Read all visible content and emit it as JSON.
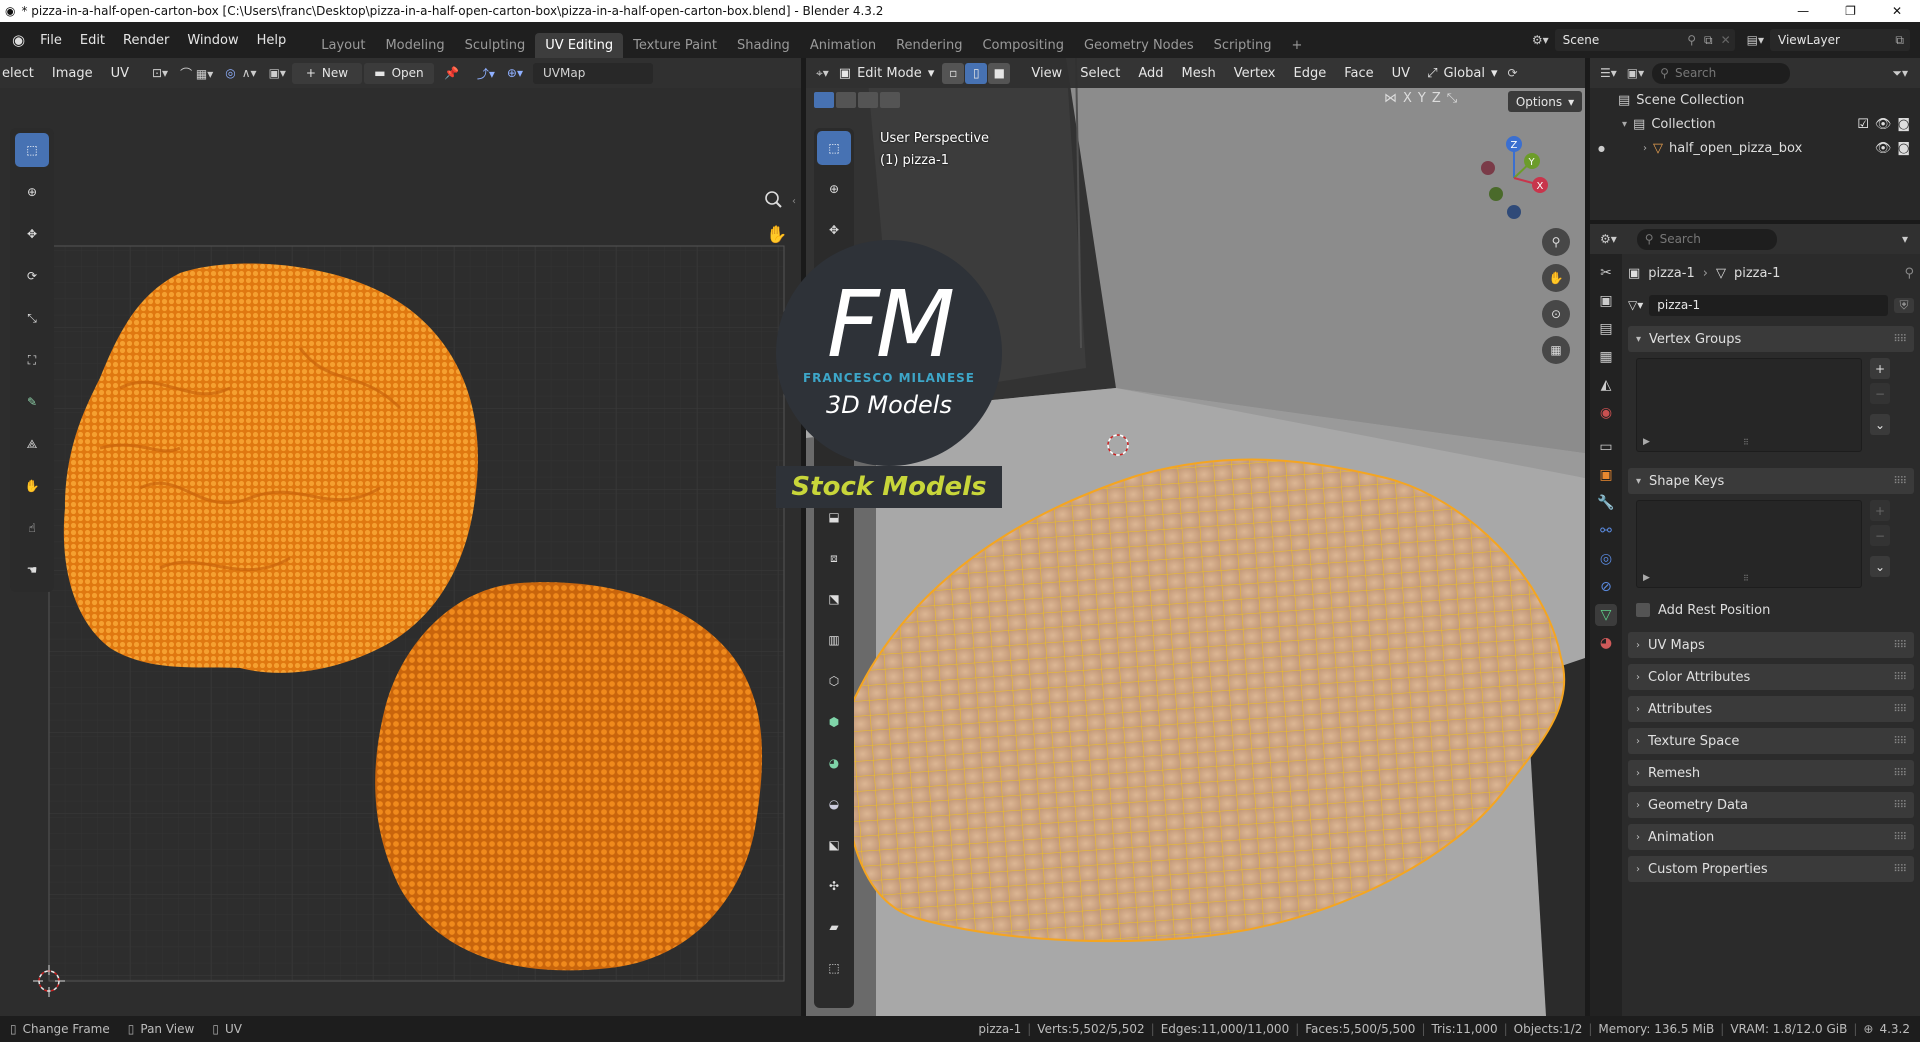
{
  "titlebar": {
    "text": "* pizza-in-a-half-open-carton-box [C:\\Users\\franc\\Desktop\\pizza-in-a-half-open-carton-box\\pizza-in-a-half-open-carton-box.blend] - Blender 4.3.2"
  },
  "menu": [
    "File",
    "Edit",
    "Render",
    "Window",
    "Help"
  ],
  "workspaces": [
    "Layout",
    "Modeling",
    "Sculpting",
    "UV Editing",
    "Texture Paint",
    "Shading",
    "Animation",
    "Rendering",
    "Compositing",
    "Geometry Nodes",
    "Scripting"
  ],
  "active_workspace": "UV Editing",
  "scene": "Scene",
  "view_layer": "ViewLayer",
  "uv_editor": {
    "menus": [
      "elect",
      "Image",
      "UV"
    ],
    "new_label": "New",
    "open_label": "Open",
    "uvmap": "UVMap"
  },
  "viewport": {
    "mode": "Edit Mode",
    "menus": [
      "View",
      "Select",
      "Add",
      "Mesh",
      "Vertex",
      "Edge",
      "Face",
      "UV"
    ],
    "orientation": "Global",
    "axes": [
      "X",
      "Y",
      "Z"
    ],
    "options": "Options",
    "perspective": "User Perspective",
    "object_label": "(1) pizza-1"
  },
  "watermark": {
    "letters": "FM",
    "name": "FRANCESCO MILANESE",
    "sub": "3D Models",
    "banner": "Stock Models"
  },
  "outliner": {
    "search_placeholder": "Search",
    "scene_collection": "Scene Collection",
    "collection": "Collection",
    "object": "half_open_pizza_box"
  },
  "properties": {
    "search_placeholder": "Search",
    "breadcrumb_object": "pizza-1",
    "breadcrumb_mesh": "pizza-1",
    "mesh_name": "pizza-1",
    "vertex_groups": "Vertex Groups",
    "shape_keys": "Shape Keys",
    "add_rest_position": "Add Rest Position",
    "panels": [
      "UV Maps",
      "Color Attributes",
      "Attributes",
      "Texture Space",
      "Remesh",
      "Geometry Data",
      "Animation",
      "Custom Properties"
    ]
  },
  "status": {
    "change_frame": "Change Frame",
    "pan_view": "Pan View",
    "uv": "UV",
    "object": "pizza-1",
    "verts": "Verts:5,502/5,502",
    "edges": "Edges:11,000/11,000",
    "faces": "Faces:5,500/5,500",
    "tris": "Tris:11,000",
    "objects": "Objects:1/2",
    "memory": "Memory: 136.5 MiB",
    "vram": "VRAM: 1.8/12.0 GiB",
    "version": "4.3.2"
  },
  "colors": {
    "accent": "#4772b3",
    "uv_orange": "#f08a1c",
    "wire": "#f5c518",
    "header_bg": "#303030"
  }
}
